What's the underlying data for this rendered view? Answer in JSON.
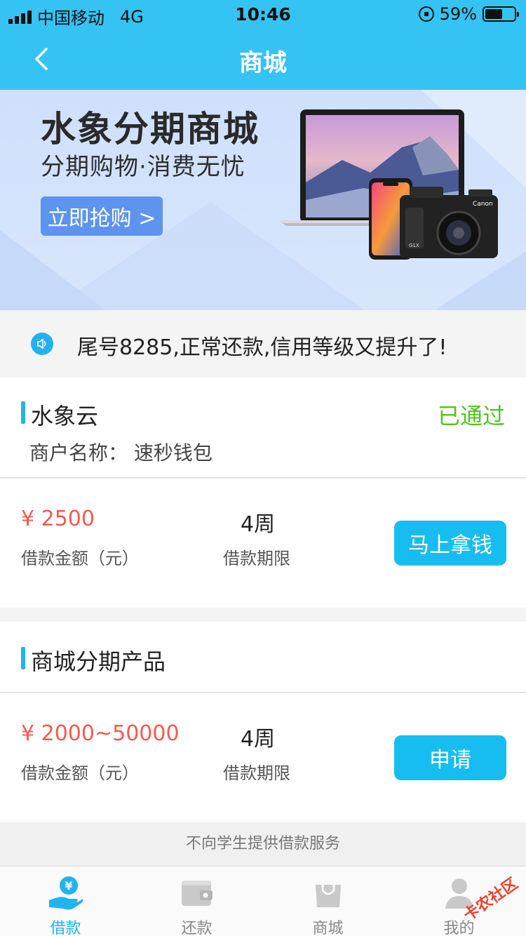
{
  "status_bar": {
    "carrier": "中国移动",
    "network": "4G",
    "time": "10:46",
    "battery": "59%",
    "battery_level": 0.59
  },
  "nav": {
    "title": "商城"
  },
  "banner": {
    "title": "水象分期商城",
    "subtitle": "分期购物·消费无忧",
    "button": "立即抢购 >"
  },
  "notice": {
    "text": "尾号8285,正常还款,信用等级又提升了!"
  },
  "cards": [
    {
      "name": "水象云",
      "status": "已通过",
      "merchant": "商户名称：  速秒钱包",
      "amount": "¥ 2500",
      "amount_label": "借款金额（元）",
      "term": "4周",
      "term_label": "借款期限",
      "button": "马上拿钱"
    },
    {
      "name": "商城分期产品",
      "amount": "¥ 2000~50000",
      "amount_label": "借款金额（元）",
      "term": "4周",
      "term_label": "借款期限",
      "button": "申请"
    }
  ],
  "footnote": "不向学生提供借款服务",
  "tabs": [
    {
      "label": "借款",
      "icon": "loan-icon",
      "active": true
    },
    {
      "label": "还款",
      "icon": "wallet-icon",
      "active": false
    },
    {
      "label": "商城",
      "icon": "shopping-bag-icon",
      "active": false
    },
    {
      "label": "我的",
      "icon": "user-icon",
      "active": false
    }
  ],
  "watermark": {
    "text": "卡农社区"
  },
  "colors": {
    "primary": "#35c3f3",
    "accent": "#17bdf0",
    "amount": "#f55a4e",
    "approved": "#52c41a",
    "banner_button": "#5c94ee"
  }
}
